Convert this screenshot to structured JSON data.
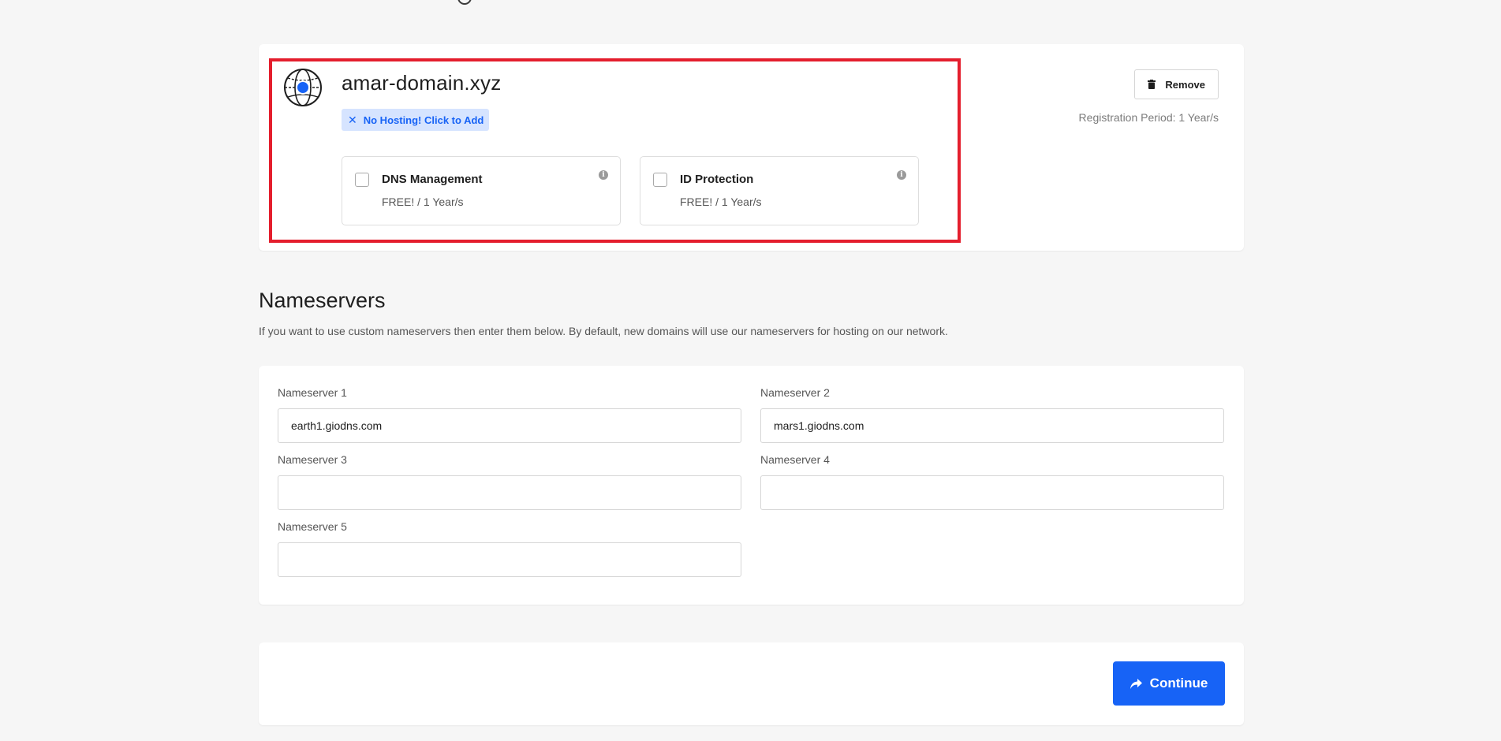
{
  "domain_card": {
    "domain_name": "amar-domain.xyz",
    "hosting_badge": "No Hosting! Click to Add",
    "remove_label": "Remove",
    "registration_period": "Registration Period: 1 Year/s",
    "addons": [
      {
        "title": "DNS Management",
        "price": "FREE! / 1 Year/s",
        "checked": false
      },
      {
        "title": "ID Protection",
        "price": "FREE! / 1 Year/s",
        "checked": false
      }
    ],
    "highlight_color": "#e41e2d",
    "badge_color": "#1763f6"
  },
  "nameservers": {
    "title": "Nameservers",
    "description": "If you want to use custom nameservers then enter them below. By default, new domains will use our nameservers for hosting on our network.",
    "fields": [
      {
        "label": "Nameserver 1",
        "value": "earth1.giodns.com"
      },
      {
        "label": "Nameserver 2",
        "value": "mars1.giodns.com"
      },
      {
        "label": "Nameserver 3",
        "value": ""
      },
      {
        "label": "Nameserver 4",
        "value": ""
      },
      {
        "label": "Nameserver 5",
        "value": ""
      }
    ]
  },
  "footer": {
    "continue_label": "Continue",
    "accent_color": "#1763f6"
  },
  "icons": {
    "domain": "globe-icon",
    "badge": "x-icon",
    "remove": "trash-icon",
    "continue": "share-arrow-icon",
    "addon_info": "info-icon"
  }
}
